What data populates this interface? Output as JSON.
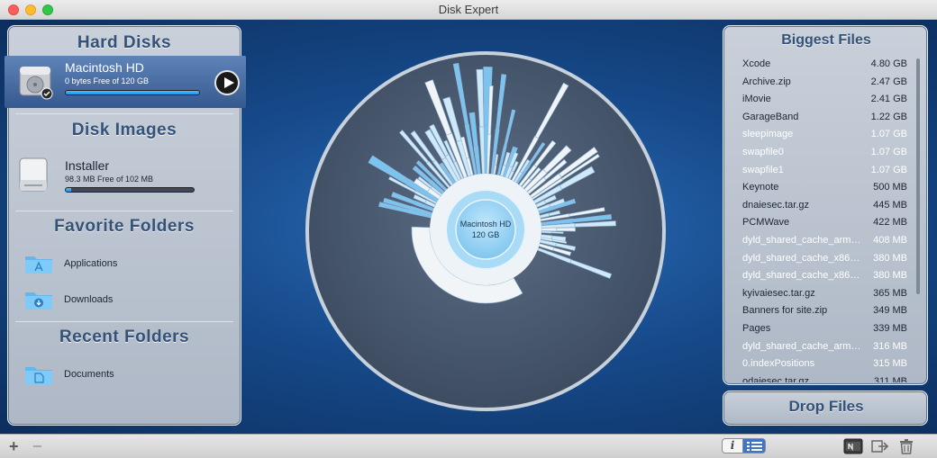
{
  "window": {
    "title": "Disk Expert"
  },
  "sidebar": {
    "hard_disks_title": "Hard Disks",
    "disk": {
      "name": "Macintosh HD",
      "detail": "0 bytes Free of 120 GB",
      "used_fraction": 1.0
    },
    "disk_images_title": "Disk Images",
    "image": {
      "name": "Installer",
      "detail": "98.3 MB Free of 102 MB",
      "used_fraction": 0.04
    },
    "favorite_folders_title": "Favorite Folders",
    "favorites": [
      {
        "label": "Applications",
        "icon": "applications-folder-icon"
      },
      {
        "label": "Downloads",
        "icon": "downloads-folder-icon"
      }
    ],
    "recent_folders_title": "Recent Folders",
    "recents": [
      {
        "label": "Documents",
        "icon": "documents-folder-icon"
      }
    ]
  },
  "chart": {
    "center_name": "Macintosh HD",
    "center_size": "120 GB"
  },
  "biggest_files": {
    "title": "Biggest Files",
    "rows": [
      {
        "name": "Xcode",
        "size": "4.80 GB",
        "hidden": false
      },
      {
        "name": "Archive.zip",
        "size": "2.47 GB",
        "hidden": false
      },
      {
        "name": "iMovie",
        "size": "2.41 GB",
        "hidden": false
      },
      {
        "name": "GarageBand",
        "size": "1.22 GB",
        "hidden": false
      },
      {
        "name": "sleepimage",
        "size": "1.07 GB",
        "hidden": true
      },
      {
        "name": "swapfile0",
        "size": "1.07 GB",
        "hidden": true
      },
      {
        "name": "swapfile1",
        "size": "1.07 GB",
        "hidden": true
      },
      {
        "name": "Keynote",
        "size": "500 MB",
        "hidden": false
      },
      {
        "name": "dnaiesec.tar.gz",
        "size": "445 MB",
        "hidden": false
      },
      {
        "name": "PCMWave",
        "size": "422 MB",
        "hidden": false
      },
      {
        "name": "dyld_shared_cache_arm…",
        "size": "408 MB",
        "hidden": true
      },
      {
        "name": "dyld_shared_cache_x86…",
        "size": "380 MB",
        "hidden": true
      },
      {
        "name": "dyld_shared_cache_x86…",
        "size": "380 MB",
        "hidden": true
      },
      {
        "name": "kyivaiesec.tar.gz",
        "size": "365 MB",
        "hidden": false
      },
      {
        "name": "Banners for site.zip",
        "size": "349 MB",
        "hidden": false
      },
      {
        "name": "Pages",
        "size": "339 MB",
        "hidden": false
      },
      {
        "name": "dyld_shared_cache_arm…",
        "size": "316 MB",
        "hidden": true
      },
      {
        "name": "0.indexPositions",
        "size": "315 MB",
        "hidden": true
      },
      {
        "name": "odaiesec.tar.gz",
        "size": "311 MB",
        "hidden": false
      }
    ]
  },
  "drop": {
    "label": "Drop Files"
  },
  "bottombar": {
    "add_label": "+",
    "remove_label": "−",
    "info_label": "i"
  },
  "colors": {
    "accent": "#345277",
    "selection": "#4a72aa",
    "bar_fill": "#2aa3f0",
    "background": "#174b8c"
  }
}
